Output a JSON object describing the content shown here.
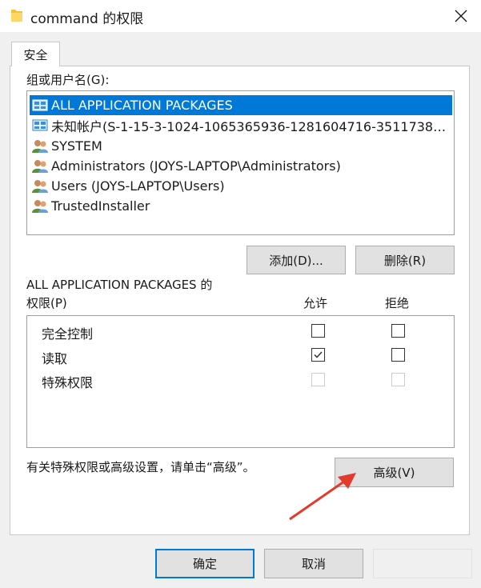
{
  "window": {
    "title": "command 的权限",
    "close_symbol": "✕"
  },
  "tabs": [
    {
      "label": "安全"
    }
  ],
  "groups_label": "组或用户名(G):",
  "principals": [
    {
      "name": "ALL APPLICATION PACKAGES",
      "icon": "app-package-icon",
      "selected": true
    },
    {
      "name": "未知帐户(S-1-15-3-1024-1065365936-1281604716-3511738…",
      "icon": "unknown-account-icon",
      "selected": false
    },
    {
      "name": "SYSTEM",
      "icon": "user-group-icon",
      "selected": false
    },
    {
      "name": "Administrators (JOYS-LAPTOP\\Administrators)",
      "icon": "user-group-icon",
      "selected": false
    },
    {
      "name": "Users (JOYS-LAPTOP\\Users)",
      "icon": "user-group-icon",
      "selected": false
    },
    {
      "name": "TrustedInstaller",
      "icon": "user-group-icon",
      "selected": false
    }
  ],
  "buttons": {
    "add": "添加(D)...",
    "remove": "删除(R)",
    "advanced": "高级(V)",
    "ok": "确定",
    "cancel": "取消",
    "apply": ""
  },
  "permissions": {
    "title_line1": "ALL APPLICATION PACKAGES 的",
    "title_line2": "权限(P)",
    "allow_header": "允许",
    "deny_header": "拒绝",
    "rows": [
      {
        "name": "完全控制",
        "allow": false,
        "deny": false,
        "enabled": true
      },
      {
        "name": "读取",
        "allow": true,
        "deny": false,
        "enabled": true
      },
      {
        "name": "特殊权限",
        "allow": false,
        "deny": false,
        "enabled": false
      }
    ]
  },
  "advanced_hint": "有关特殊权限或高级设置，请单击“高级”。",
  "colors": {
    "selection": "#0078d7",
    "arrow": "#e23b2e",
    "folder": "#f5c13c"
  }
}
